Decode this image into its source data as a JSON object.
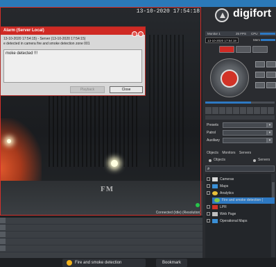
{
  "camera": {
    "timestamp": "13-10-2020 17:54:18",
    "overlay_label": "FM",
    "connection_status": "Connected (Idle) (Resolution)"
  },
  "alarm_dialog": {
    "title": "Alarm (Server Local)",
    "line1": "13-10-2020 17:54:15) - Server (13-10-2020 17:54:15)",
    "line2": "e detected in camera fire and smoke detection zone 001",
    "message": "moke detected !!!",
    "playback_label": "Playback",
    "close_label": "Close"
  },
  "taskbar": {
    "center_label": "Fire and smoke detection",
    "right_label": "Bookmark"
  },
  "panel": {
    "logo_text": "digifort",
    "monitor_label": "Monitor 1",
    "fps_label": "25 FPS",
    "cpu_label": "CPU",
    "timestamp": "13-10-2020 17:54:18",
    "mem_label": "Mem",
    "presets_label": "Presets",
    "patrol_label": "Patrol",
    "auxiliary_label": "Auxiliary",
    "tab_objects": "Objects",
    "tab_monitors": "Monitors",
    "tab_servers": "Servers",
    "radio_objects": "Objects",
    "radio_servers": "Servers",
    "tree": [
      {
        "label": "Cameras",
        "selected": false
      },
      {
        "label": "Maps",
        "selected": false
      },
      {
        "label": "Analytics",
        "selected": false
      },
      {
        "label": "Fire and smoke detection (",
        "selected": true
      },
      {
        "label": "LPR",
        "selected": false
      },
      {
        "label": "Web Page",
        "selected": false
      },
      {
        "label": "Operational Maps",
        "selected": false
      }
    ]
  },
  "colors": {
    "accent_blue": "#2e79c3",
    "alarm_red": "#cf2a24",
    "status_green": "#27c44a"
  }
}
